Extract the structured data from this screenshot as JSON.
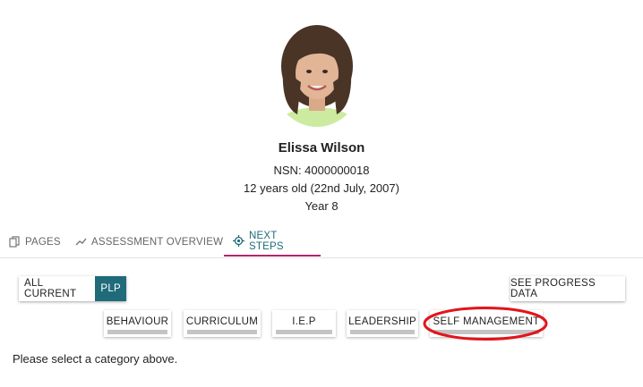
{
  "student": {
    "name": "Elissa Wilson",
    "nsn": "NSN: 4000000018",
    "age": "12 years old (22nd July, 2007)",
    "year": "Year 8"
  },
  "tabs": [
    {
      "label": "PAGES",
      "icon": "pages-icon"
    },
    {
      "label": "ASSESSMENT OVERVIEW",
      "icon": "trend-icon"
    },
    {
      "label": "NEXT STEPS",
      "icon": "target-icon",
      "active": true
    }
  ],
  "filter": {
    "all_current": "ALL CURRENT",
    "plp": "PLP"
  },
  "progress_button": "SEE PROGRESS DATA",
  "categories": [
    "BEHAVIOUR",
    "CURRICULUM",
    "I.E.P",
    "LEADERSHIP",
    "SELF MANAGEMENT"
  ],
  "message": "Please select a category above.",
  "colors": {
    "accent": "#1f6b7a",
    "active_tab_underline": "#b0266e",
    "annotation": "#e3141b"
  }
}
